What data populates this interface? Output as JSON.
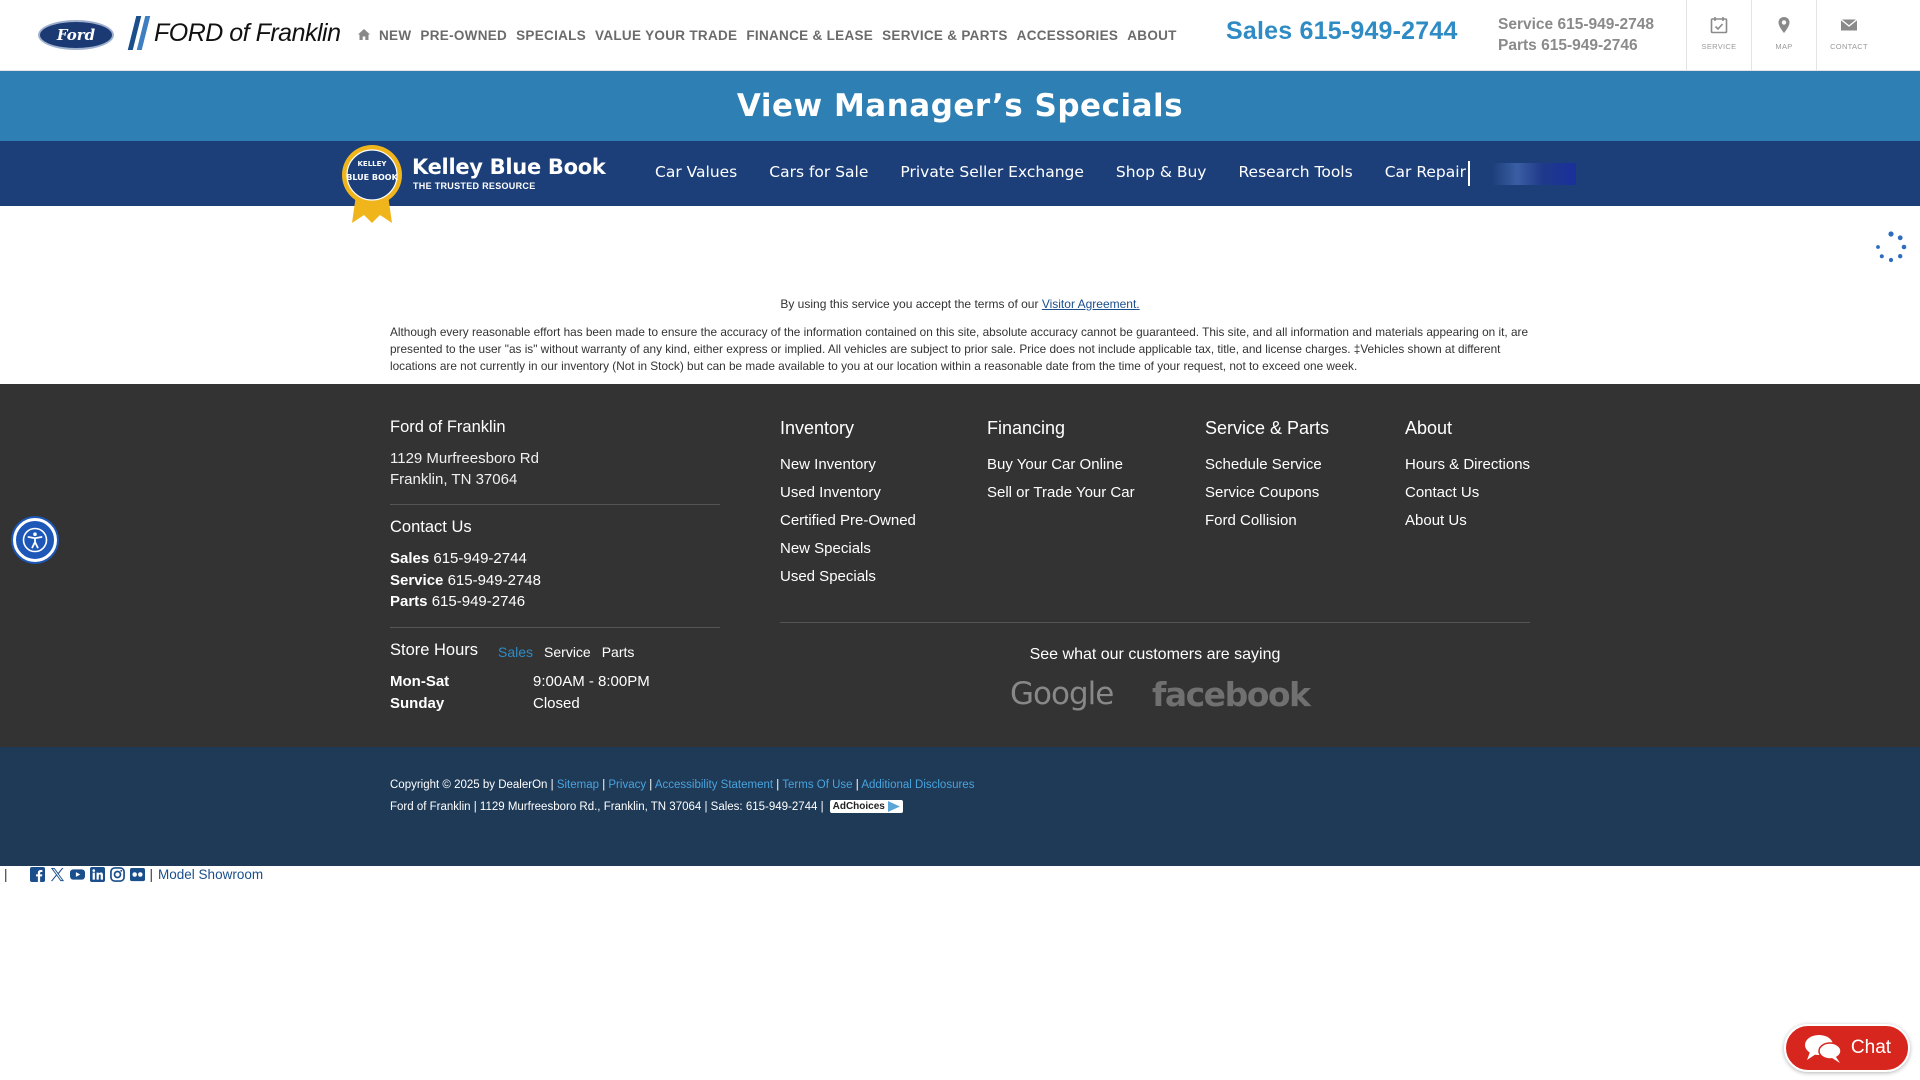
{
  "header": {
    "ford_logo": "Ford",
    "dealer_name": "FORD of Franklin",
    "nav": [
      "NEW",
      "PRE-OWNED",
      "SPECIALS",
      "VALUE YOUR TRADE",
      "FINANCE & LEASE",
      "SERVICE & PARTS",
      "ACCESSORIES",
      "ABOUT"
    ],
    "sales_label": "Sales",
    "sales_phone": "615-949-2744",
    "service_label": "Service",
    "service_phone": "615-949-2748",
    "parts_label": "Parts",
    "parts_phone": "615-949-2746",
    "icons": [
      {
        "label": "SERVICE",
        "icon": "calendar-check-icon"
      },
      {
        "label": "MAP",
        "icon": "map-pin-icon"
      },
      {
        "label": "CONTACT",
        "icon": "envelope-icon"
      }
    ]
  },
  "banner": {
    "text": "View Manager’s Specials",
    "color": "#2e7fb4"
  },
  "kbb": {
    "title": "Kelley Blue Book",
    "subtitle": "THE TRUSTED RESOURCE",
    "badge_line1": "KELLEY",
    "badge_line2": "BLUE BOOK",
    "nav": [
      "Car Values",
      "Cars for Sale",
      "Private Seller Exchange",
      "Shop & Buy",
      "Research Tools",
      "Car Repair"
    ],
    "bar_color": "#1c3f7a"
  },
  "terms": {
    "text": "By using this service you accept the terms of our",
    "link": "Visitor Agreement."
  },
  "disclaimer": "Although every reasonable effort has been made to ensure the accuracy of the information contained on this site, absolute accuracy cannot be guaranteed. This site, and all information and materials appearing on it, are presented to the user \"as is\" without warranty of any kind, either express or implied. All vehicles are subject to prior sale. Price does not include applicable tax, title, and license charges. ‡Vehicles shown at different locations are not currently in our inventory (Not in Stock) but can be made available to you at our location within a reasonable date from the time of your request, not to exceed one week.",
  "footer": {
    "dealer": "Ford of Franklin",
    "address1": "1129 Murfreesboro Rd",
    "address2": "Franklin, TN 37064",
    "contact_heading": "Contact Us",
    "contacts": [
      {
        "label": "Sales",
        "phone": "615-949-2744"
      },
      {
        "label": "Service",
        "phone": "615-949-2748"
      },
      {
        "label": "Parts",
        "phone": "615-949-2746"
      }
    ],
    "hours_heading": "Store Hours",
    "hours_tabs": [
      "Sales",
      "Service",
      "Parts"
    ],
    "hours": [
      {
        "day": "Mon-Sat",
        "time": "9:00AM - 8:00PM"
      },
      {
        "day": "Sunday",
        "time": "Closed"
      }
    ],
    "columns": [
      {
        "heading": "Inventory",
        "links": [
          "New Inventory",
          "Used Inventory",
          "Certified Pre-Owned",
          "New Specials",
          "Used Specials"
        ]
      },
      {
        "heading": "Financing",
        "links": [
          "Buy Your Car Online",
          "Sell or Trade Your Car"
        ]
      },
      {
        "heading": "Service & Parts",
        "links": [
          "Schedule Service",
          "Service Coupons",
          "Ford Collision"
        ]
      },
      {
        "heading": "About",
        "links": [
          "Hours & Directions",
          "Contact Us",
          "About Us"
        ]
      }
    ],
    "reviews_heading": "See what our customers are saying",
    "google": "Google",
    "facebook": "facebook"
  },
  "legal": {
    "copyright": "Copyright © 2025 by DealerOn |",
    "links": [
      "Sitemap",
      "Privacy",
      "Accessibility Statement",
      "Terms Of Use",
      "Additional Disclosures"
    ],
    "line2": "Ford of Franklin | 1129 Murfreesboro Rd., Franklin, TN 37064 | Sales: 615-949-2744 |",
    "adchoices": "AdChoices"
  },
  "below_footer": {
    "social": [
      "facebook-icon",
      "x-icon",
      "youtube-icon",
      "linkedin-icon",
      "instagram-icon",
      "flickr-icon"
    ],
    "model_showroom": "Model Showroom"
  },
  "chat": {
    "label": "Chat",
    "color": "#d7261e"
  }
}
